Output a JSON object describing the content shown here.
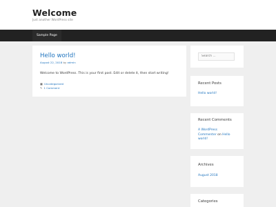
{
  "site": {
    "title": "Welcome",
    "description": "Just another WordPress site"
  },
  "nav": {
    "items": [
      {
        "label": "Sample Page"
      }
    ]
  },
  "post": {
    "title": "Hello world!",
    "date": "August 22, 2018",
    "by": "by",
    "author": "admin",
    "body": "Welcome to WordPress. This is your first post. Edit or delete it, then start writing!",
    "category_icon": "folder-icon",
    "category": "Uncategorized",
    "comments_icon": "comment-icon",
    "comments": "1 Comment"
  },
  "sidebar": {
    "search": {
      "placeholder": "Search ..."
    },
    "recent_posts": {
      "title": "Recent Posts",
      "items": [
        "Hello world!"
      ]
    },
    "recent_comments": {
      "title": "Recent Comments",
      "commenter_line1": "A WordPress",
      "commenter_line2": "Commenter",
      "on": "on",
      "post_line1": "Hello",
      "post_line2": "world!"
    },
    "archives": {
      "title": "Archives",
      "items": [
        "August 2018"
      ]
    },
    "categories": {
      "title": "Categories"
    }
  }
}
